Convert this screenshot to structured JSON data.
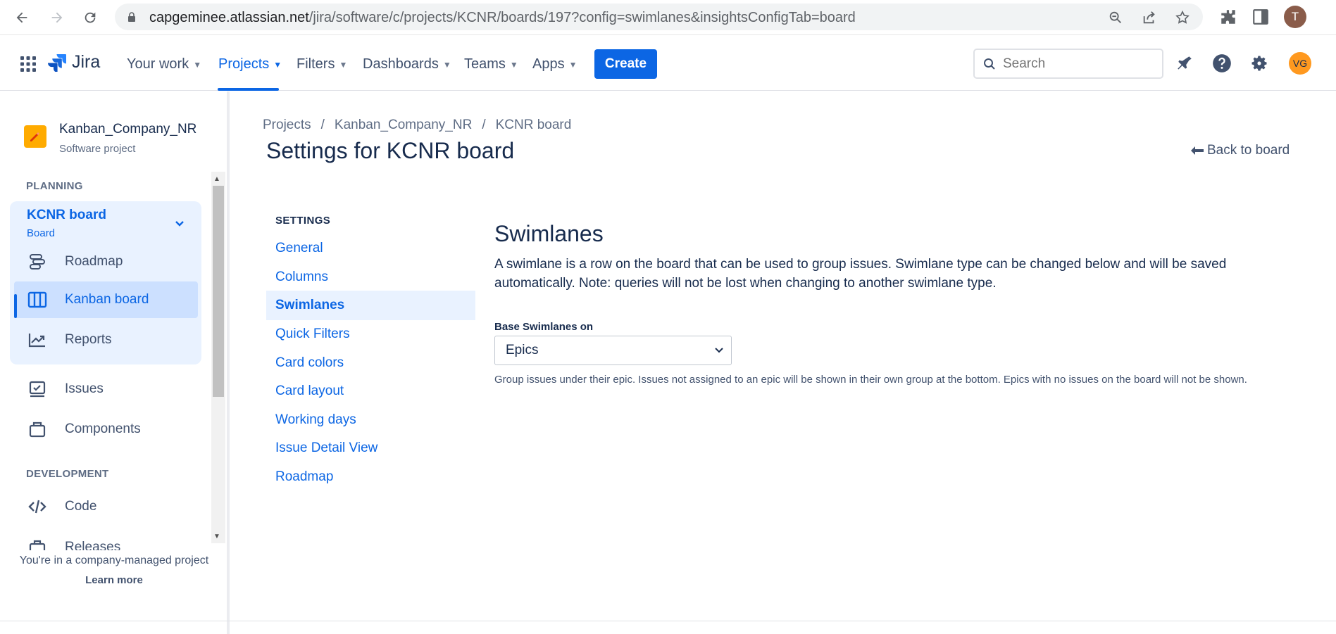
{
  "browser": {
    "url_host": "capgeminee.atlassian.net",
    "url_path": "/jira/software/c/projects/KCNR/boards/197?config=swimlanes&insightsConfigTab=board",
    "profile_initial": "T"
  },
  "topnav": {
    "logo_text": "Jira",
    "menu": [
      {
        "label": "Your work"
      },
      {
        "label": "Projects"
      },
      {
        "label": "Filters"
      },
      {
        "label": "Dashboards"
      },
      {
        "label": "Teams"
      },
      {
        "label": "Apps"
      }
    ],
    "create_label": "Create",
    "search_placeholder": "Search",
    "avatar_initials": "VG",
    "accent_color": "#0c66e4"
  },
  "sidebar": {
    "project_name": "Kanban_Company_NR",
    "project_type": "Software project",
    "planning_label": "PLANNING",
    "board_title": "KCNR board",
    "board_subtitle": "Board",
    "board_items": [
      {
        "label": "Roadmap",
        "icon": "roadmap-icon"
      },
      {
        "label": "Kanban board",
        "icon": "kanban-icon",
        "selected": true
      },
      {
        "label": "Reports",
        "icon": "reports-icon"
      }
    ],
    "items": [
      {
        "label": "Issues",
        "icon": "issues-icon"
      },
      {
        "label": "Components",
        "icon": "components-icon"
      }
    ],
    "development_label": "DEVELOPMENT",
    "dev_items": [
      {
        "label": "Code",
        "icon": "code-icon"
      },
      {
        "label": "Releases",
        "icon": "releases-icon"
      }
    ],
    "footer_text": "You're in a company-managed project",
    "footer_link": "Learn more"
  },
  "main": {
    "breadcrumb": [
      "Projects",
      "/",
      "Kanban_Company_NR",
      "/",
      "KCNR board"
    ],
    "title": "Settings for KCNR board",
    "back_link": "Back to board",
    "settings_label": "SETTINGS",
    "settings_nav": [
      {
        "label": "General"
      },
      {
        "label": "Columns"
      },
      {
        "label": "Swimlanes",
        "current": true
      },
      {
        "label": "Quick Filters"
      },
      {
        "label": "Card colors"
      },
      {
        "label": "Card layout"
      },
      {
        "label": "Working days"
      },
      {
        "label": "Issue Detail View"
      },
      {
        "label": "Roadmap"
      }
    ],
    "section_title": "Swimlanes",
    "section_desc": "A swimlane is a row on the board that can be used to group issues. Swimlane type can be changed below and will be saved automatically. Note: queries will not be lost when changing to another swimlane type.",
    "field_label": "Base Swimlanes on",
    "field_value": "Epics",
    "helper_text": "Group issues under their epic. Issues not assigned to an epic will be shown in their own group at the bottom. Epics with no issues on the board will not be shown."
  }
}
